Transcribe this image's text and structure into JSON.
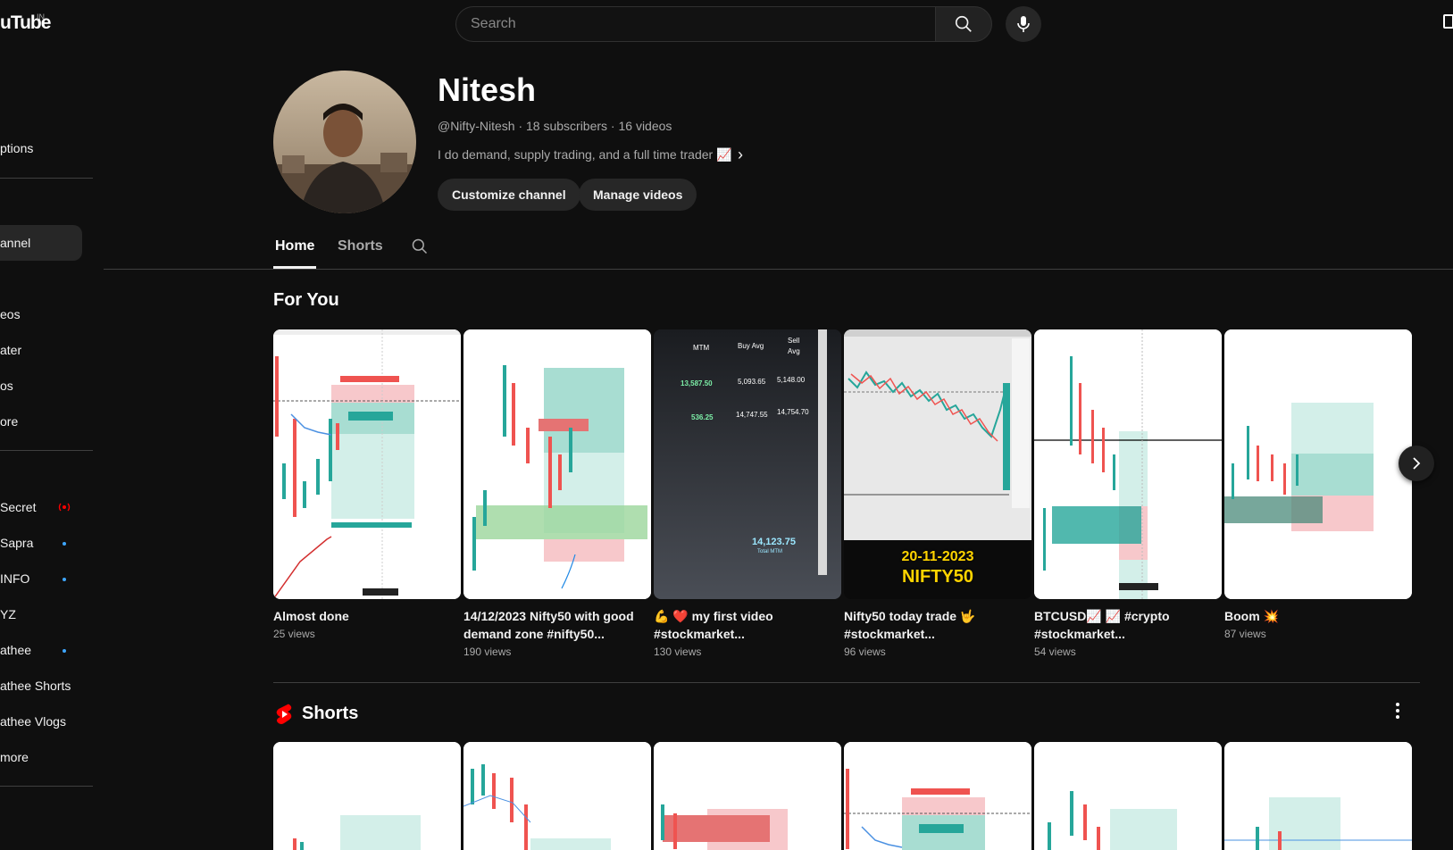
{
  "header": {
    "logo_text": "uTube",
    "logo_region": "IN",
    "search_placeholder": "Search"
  },
  "sidebar": {
    "items": [
      {
        "label": "ptions"
      },
      {
        "label": "annel"
      },
      {
        "label": "eos"
      },
      {
        "label": "ater"
      },
      {
        "label": "os"
      },
      {
        "label": "ore"
      },
      {
        "label": "Secret"
      },
      {
        "label": "Sapra"
      },
      {
        "label": "INFO"
      },
      {
        "label": "YZ"
      },
      {
        "label": "athee"
      },
      {
        "label": "athee Shorts"
      },
      {
        "label": "athee Vlogs"
      },
      {
        "label": " more"
      }
    ]
  },
  "channel": {
    "name": "Nitesh",
    "meta": "@Nifty-Nitesh · 18 subscribers · 16 videos",
    "description": "I do demand, supply trading, and a full time trader 📈",
    "customize_label": "Customize channel",
    "manage_label": "Manage videos"
  },
  "tabs": {
    "home": "Home",
    "shorts": "Shorts"
  },
  "for_you": {
    "title": "For You",
    "videos": [
      {
        "title": "Almost done",
        "views": "25 views"
      },
      {
        "title": "14/12/2023 Nifty50 with good demand zone #nifty50...",
        "views": "190 views"
      },
      {
        "title": "💪 ❤️ my first video #stockmarket...",
        "views": "130 views"
      },
      {
        "title": "Nifty50 today trade 🤟 #stockmarket...",
        "views": "96 views"
      },
      {
        "title": "BTCUSD📈 📈 #crypto #stockmarket...",
        "views": "54 views"
      },
      {
        "title": "Boom 💥",
        "views": "87 views"
      }
    ],
    "thumb3": {
      "col1": "MTM",
      "col2": "Buy Avg",
      "col3": "Sell Avg",
      "r1a": "13,587.50",
      "r1b": "5,093.65",
      "r1c": "5,148.00",
      "r2a": "536.25",
      "r2b": "14,747.55",
      "r2c": "14,754.70",
      "total": "14,123.75",
      "total_label": "Total MTM"
    },
    "thumb4": {
      "date": "20-11-2023",
      "ticker": "NIFTY50"
    }
  },
  "shorts_section": {
    "title": "Shorts"
  },
  "colors": {
    "background": "#0f0f0f",
    "accent_red": "#ff0000",
    "live_dot": "#3ea6ff",
    "bull": "#26a69a",
    "bear": "#ef5350"
  }
}
